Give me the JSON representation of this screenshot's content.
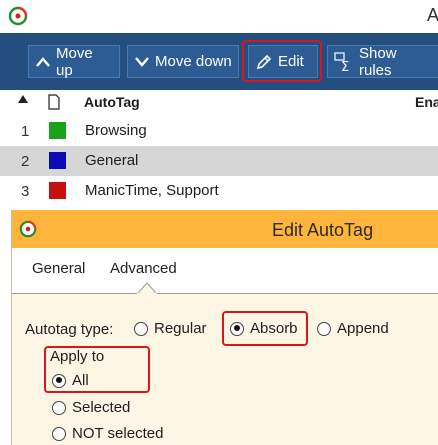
{
  "window": {
    "title_fragment": "A"
  },
  "toolbar": {
    "move_up": "Move up",
    "move_down": "Move down",
    "edit": "Edit",
    "show_rules": "Show rules",
    "background": "#234e7f"
  },
  "list": {
    "header": {
      "name_col": "AutoTag",
      "enabled_col": "Ena"
    },
    "rows": [
      {
        "num": "1",
        "name": "Browsing",
        "color": "#1aa31a"
      },
      {
        "num": "2",
        "name": "General",
        "color": "#0b0bb5"
      },
      {
        "num": "3",
        "name": "ManicTime, Support",
        "color": "#c80f0f"
      }
    ],
    "selected_row": 2
  },
  "dialog": {
    "title": "Edit AutoTag",
    "title_bar_color": "#ffb43b",
    "tabs": [
      "General",
      "Advanced"
    ],
    "active_tab": "Advanced",
    "autotag_type": {
      "label": "Autotag type:",
      "options": [
        "Regular",
        "Absorb",
        "Append"
      ],
      "selected": "Absorb"
    },
    "apply_to": {
      "label": "Apply to",
      "options": [
        "All",
        "Selected",
        "NOT selected"
      ],
      "selected": "All"
    }
  },
  "icons": [
    "manictime-logo-icon",
    "arrow-up-icon",
    "arrow-down-icon",
    "pencil-icon",
    "sigma-icon",
    "document-icon",
    "sort-up-icon"
  ]
}
